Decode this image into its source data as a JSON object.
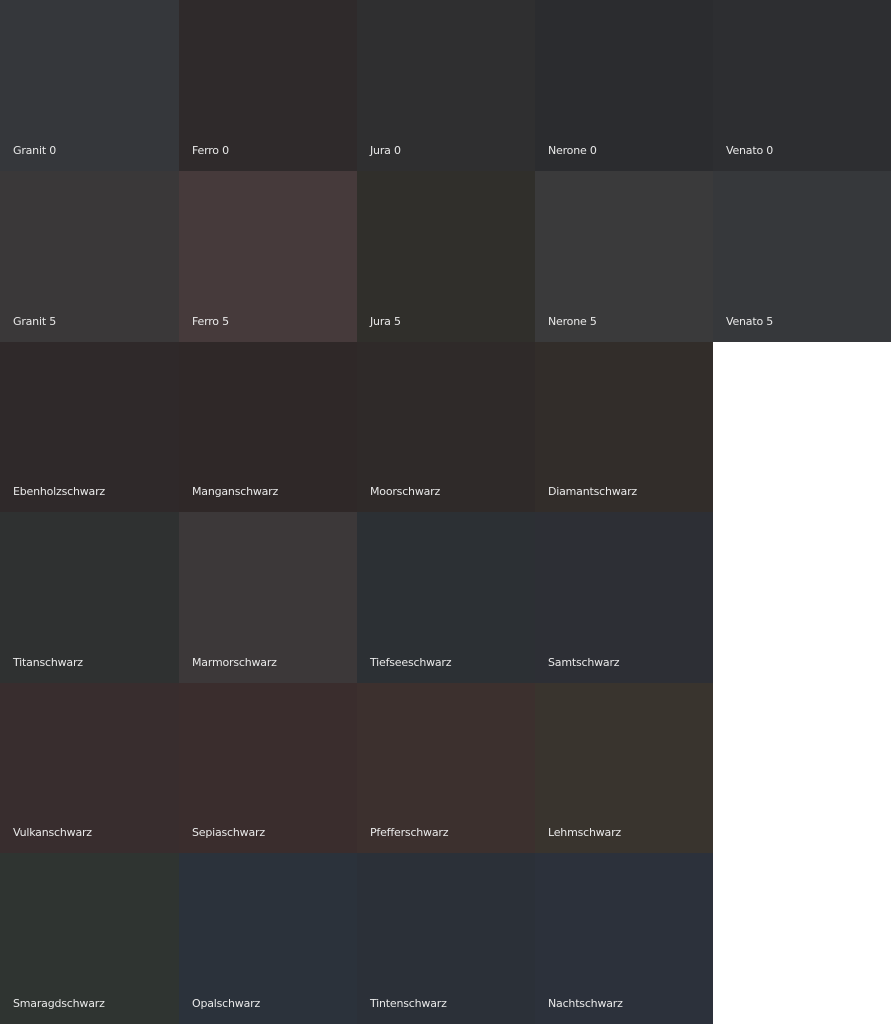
{
  "swatches": [
    {
      "label": "Granit 0",
      "color": "#35373b"
    },
    {
      "label": "Ferro 0",
      "color": "#2f2a2b"
    },
    {
      "label": "Jura 0",
      "color": "#2f2f30"
    },
    {
      "label": "Nerone 0",
      "color": "#2b2c2f"
    },
    {
      "label": "Venato 0",
      "color": "#2d2e31"
    },
    {
      "label": "Granit 5",
      "color": "#3a3839"
    },
    {
      "label": "Ferro 5",
      "color": "#463a3b"
    },
    {
      "label": "Jura 5",
      "color": "#302f2b"
    },
    {
      "label": "Nerone 5",
      "color": "#3a3a3b"
    },
    {
      "label": "Venato 5",
      "color": "#36383b"
    },
    {
      "label": "Ebenholzschwarz",
      "color": "#2f292a"
    },
    {
      "label": "Manganschwarz",
      "color": "#2f2828"
    },
    {
      "label": "Moorschwarz",
      "color": "#2f2a29"
    },
    {
      "label": "Diamantschwarz",
      "color": "#322d2a"
    },
    {
      "label": "",
      "color": "#ffffff"
    },
    {
      "label": "Titanschwarz",
      "color": "#2f3131"
    },
    {
      "label": "Marmorschwarz",
      "color": "#3c3839"
    },
    {
      "label": "Tiefseeschwarz",
      "color": "#2c3034"
    },
    {
      "label": "Samtschwarz",
      "color": "#2d2f35"
    },
    {
      "label": "",
      "color": "#ffffff"
    },
    {
      "label": "Vulkanschwarz",
      "color": "#382d2e"
    },
    {
      "label": "Sepiaschwarz",
      "color": "#3a2d2d"
    },
    {
      "label": "Pfefferschwarz",
      "color": "#3c302e"
    },
    {
      "label": "Lehmschwarz",
      "color": "#39342e"
    },
    {
      "label": "",
      "color": "#ffffff"
    },
    {
      "label": "Smaragdschwarz",
      "color": "#2f3431"
    },
    {
      "label": "Opalschwarz",
      "color": "#2b323b"
    },
    {
      "label": "Tintenschwarz",
      "color": "#2b3038"
    },
    {
      "label": "Nachtschwarz",
      "color": "#2c313b"
    },
    {
      "label": "",
      "color": "#ffffff"
    }
  ]
}
